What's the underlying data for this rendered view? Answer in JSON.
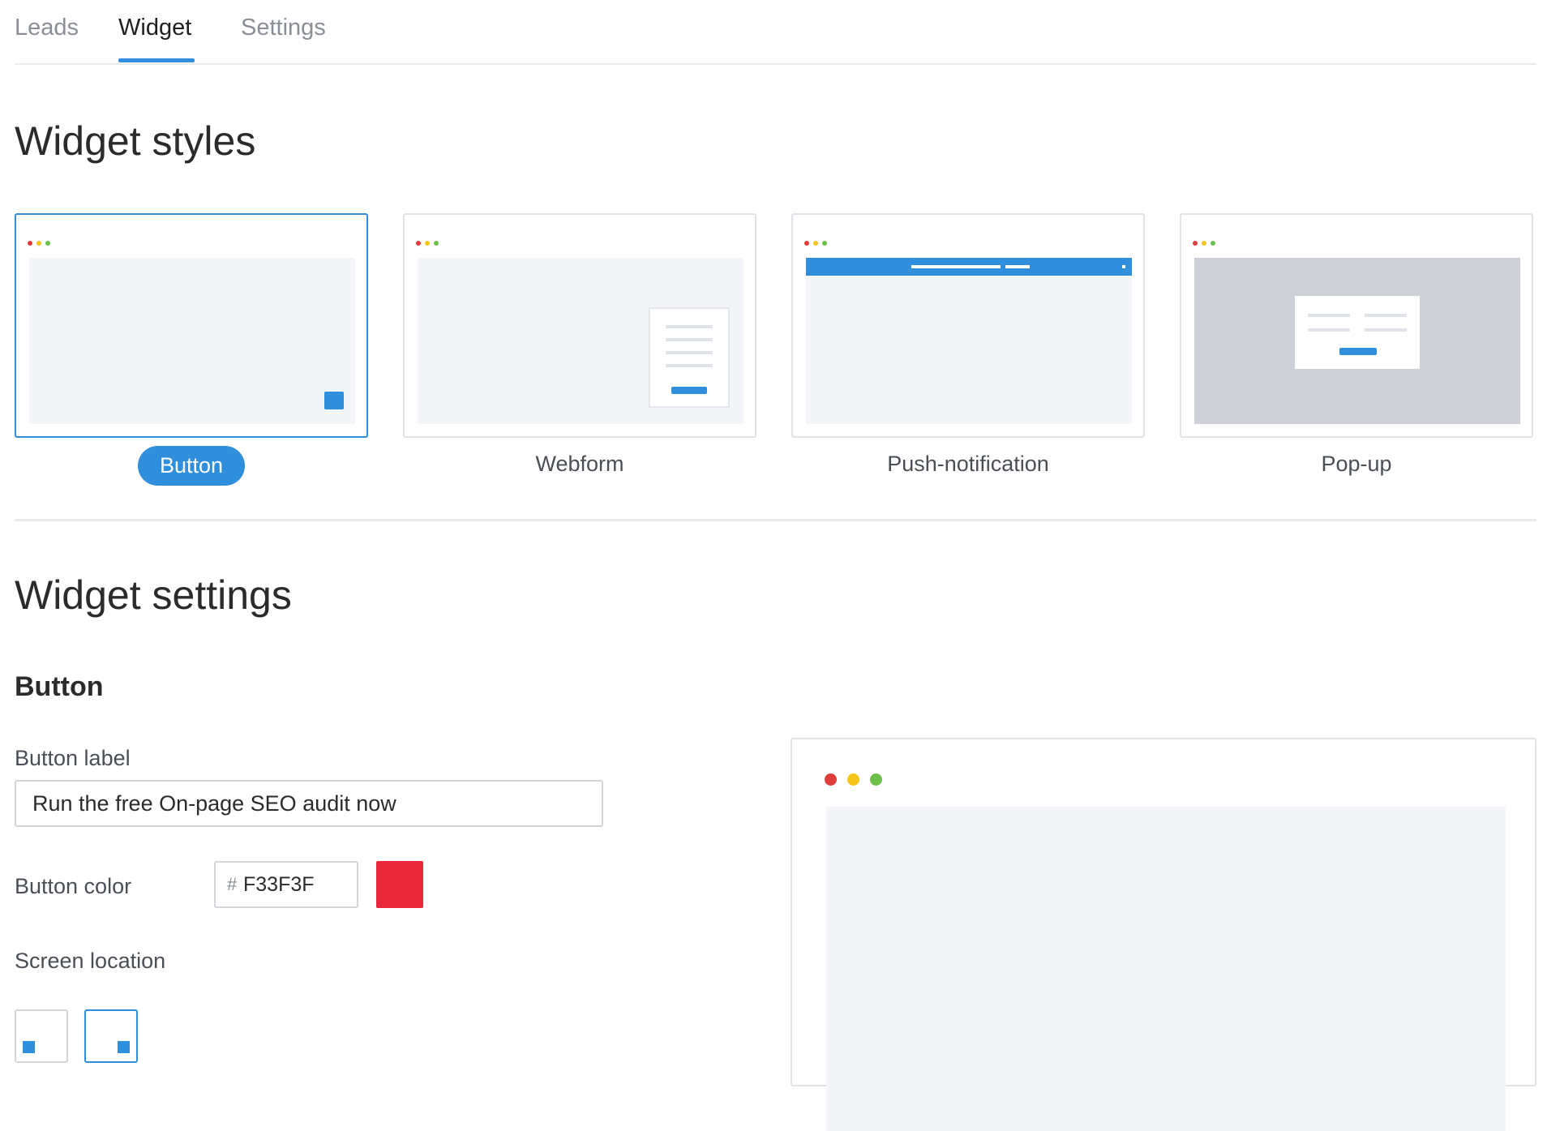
{
  "tabs": [
    {
      "label": "Leads"
    },
    {
      "label": "Widget",
      "active": true
    },
    {
      "label": "Settings"
    }
  ],
  "styles_title": "Widget styles",
  "widget_styles": [
    {
      "label": "Button",
      "selected": true
    },
    {
      "label": "Webform"
    },
    {
      "label": "Push-notification"
    },
    {
      "label": "Pop-up"
    }
  ],
  "settings_title": "Widget settings",
  "settings": {
    "section_title": "Button",
    "button_label": {
      "label": "Button label",
      "value": "Run the free On-page SEO audit now"
    },
    "button_color": {
      "label": "Button color",
      "prefix": "#",
      "value": "F33F3F",
      "swatch": "#e8283a"
    },
    "screen_location": {
      "label": "Screen location",
      "selected": "right"
    }
  },
  "colors": {
    "accent": "#2f8fdd",
    "dot_red": "#e03c3c",
    "dot_yellow": "#f5c518",
    "dot_green": "#6cc04a"
  }
}
